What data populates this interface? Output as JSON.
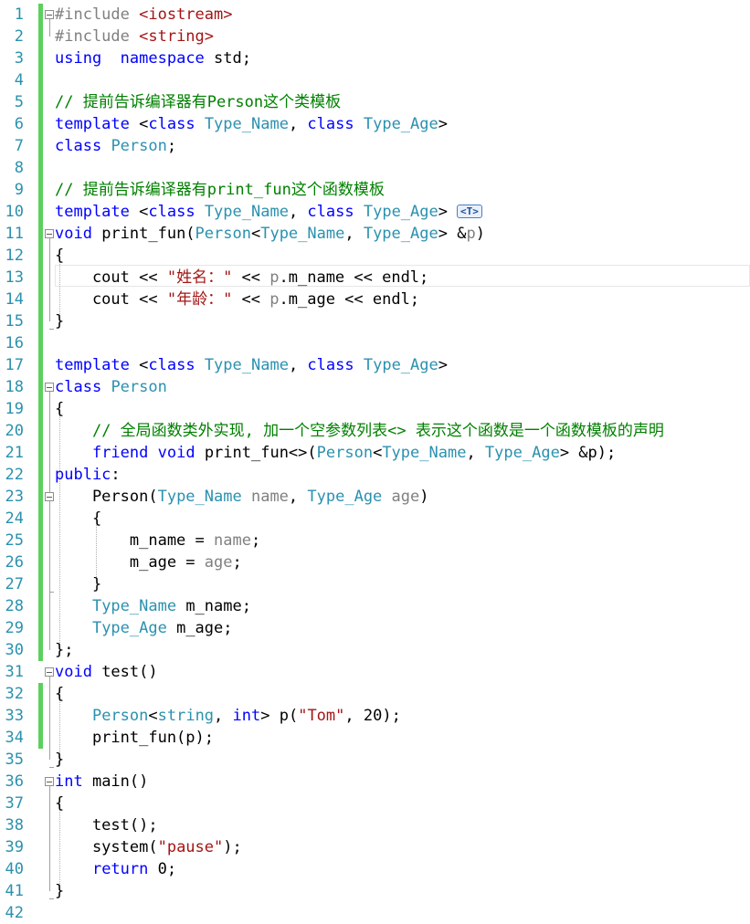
{
  "editor": {
    "colors": {
      "keyword": "#0000ff",
      "type": "#2b91af",
      "comment": "#008000",
      "string": "#a31515",
      "line_number": "#2b91af",
      "change_bar": "#5cd05c"
    },
    "line_numbers": [
      "1",
      "2",
      "3",
      "4",
      "5",
      "6",
      "7",
      "8",
      "9",
      "10",
      "11",
      "12",
      "13",
      "14",
      "15",
      "16",
      "17",
      "18",
      "19",
      "20",
      "21",
      "22",
      "23",
      "24",
      "25",
      "26",
      "27",
      "28",
      "29",
      "30",
      "31",
      "32",
      "33",
      "34",
      "35",
      "36",
      "37",
      "38",
      "39",
      "40",
      "41",
      "42"
    ],
    "hint_badge": "<T>",
    "lines": [
      [
        [
          "pp",
          "#include "
        ],
        [
          "st",
          "<iostream>"
        ]
      ],
      [
        [
          "pp",
          "#include "
        ],
        [
          "st",
          "<string>"
        ]
      ],
      [
        [
          "kw",
          "using"
        ],
        [
          "",
          "  "
        ],
        [
          "kw",
          "namespace"
        ],
        [
          "",
          " std;"
        ]
      ],
      [],
      [
        [
          "cm",
          "// 提前告诉编译器有Person这个类模板"
        ]
      ],
      [
        [
          "kw",
          "template"
        ],
        [
          "",
          " <"
        ],
        [
          "kw",
          "class"
        ],
        [
          "",
          " "
        ],
        [
          "ty",
          "Type_Name"
        ],
        [
          "",
          ", "
        ],
        [
          "kw",
          "class"
        ],
        [
          "",
          " "
        ],
        [
          "ty",
          "Type_Age"
        ],
        [
          "",
          ">"
        ]
      ],
      [
        [
          "kw",
          "class"
        ],
        [
          "",
          " "
        ],
        [
          "ty",
          "Person"
        ],
        [
          "",
          ";"
        ]
      ],
      [],
      [
        [
          "cm",
          "// 提前告诉编译器有print_fun这个函数模板"
        ]
      ],
      [
        [
          "kw",
          "template"
        ],
        [
          "",
          " <"
        ],
        [
          "kw",
          "class"
        ],
        [
          "",
          " "
        ],
        [
          "ty",
          "Type_Name"
        ],
        [
          "",
          ", "
        ],
        [
          "kw",
          "class"
        ],
        [
          "",
          " "
        ],
        [
          "ty",
          "Type_Age"
        ],
        [
          "",
          ">"
        ]
      ],
      [
        [
          "kw",
          "void"
        ],
        [
          "",
          " print_fun("
        ],
        [
          "ty",
          "Person"
        ],
        [
          "",
          "<"
        ],
        [
          "ty",
          "Type_Name"
        ],
        [
          "",
          ", "
        ],
        [
          "ty",
          "Type_Age"
        ],
        [
          "",
          "> &"
        ],
        [
          "pa",
          "p"
        ],
        [
          "",
          ")"
        ]
      ],
      [
        [
          "",
          "{"
        ]
      ],
      [
        [
          "",
          "    cout << "
        ],
        [
          "st",
          "\"姓名：\""
        ],
        [
          "",
          " << "
        ],
        [
          "pa",
          "p"
        ],
        [
          "",
          ".m_name << endl;"
        ]
      ],
      [
        [
          "",
          "    cout << "
        ],
        [
          "st",
          "\"年龄：\""
        ],
        [
          "",
          " << "
        ],
        [
          "pa",
          "p"
        ],
        [
          "",
          ".m_age << endl;"
        ]
      ],
      [
        [
          "",
          "}"
        ]
      ],
      [],
      [
        [
          "kw",
          "template"
        ],
        [
          "",
          " <"
        ],
        [
          "kw",
          "class"
        ],
        [
          "",
          " "
        ],
        [
          "ty",
          "Type_Name"
        ],
        [
          "",
          ", "
        ],
        [
          "kw",
          "class"
        ],
        [
          "",
          " "
        ],
        [
          "ty",
          "Type_Age"
        ],
        [
          "",
          ">"
        ]
      ],
      [
        [
          "kw",
          "class"
        ],
        [
          "",
          " "
        ],
        [
          "ty",
          "Person"
        ]
      ],
      [
        [
          "",
          "{"
        ]
      ],
      [
        [
          "",
          "    "
        ],
        [
          "cm",
          "// 全局函数类外实现, 加一个空参数列表<> 表示这个函数是一个函数模板的声明"
        ]
      ],
      [
        [
          "",
          "    "
        ],
        [
          "kw",
          "friend"
        ],
        [
          "",
          " "
        ],
        [
          "kw",
          "void"
        ],
        [
          "",
          " print_fun<>("
        ],
        [
          "ty",
          "Person"
        ],
        [
          "",
          "<"
        ],
        [
          "ty",
          "Type_Name"
        ],
        [
          "",
          ", "
        ],
        [
          "ty",
          "Type_Age"
        ],
        [
          "",
          "> &p);"
        ]
      ],
      [
        [
          "kw",
          "public"
        ],
        [
          "",
          ":"
        ]
      ],
      [
        [
          "",
          "    Person("
        ],
        [
          "ty",
          "Type_Name"
        ],
        [
          "",
          " "
        ],
        [
          "pa",
          "name"
        ],
        [
          "",
          ", "
        ],
        [
          "ty",
          "Type_Age"
        ],
        [
          "",
          " "
        ],
        [
          "pa",
          "age"
        ],
        [
          "",
          ")"
        ]
      ],
      [
        [
          "",
          "    {"
        ]
      ],
      [
        [
          "",
          "        m_name = "
        ],
        [
          "pa",
          "name"
        ],
        [
          "",
          ";"
        ]
      ],
      [
        [
          "",
          "        m_age = "
        ],
        [
          "pa",
          "age"
        ],
        [
          "",
          ";"
        ]
      ],
      [
        [
          "",
          "    }"
        ]
      ],
      [
        [
          "",
          "    "
        ],
        [
          "ty",
          "Type_Name"
        ],
        [
          "",
          " m_name;"
        ]
      ],
      [
        [
          "",
          "    "
        ],
        [
          "ty",
          "Type_Age"
        ],
        [
          "",
          " m_age;"
        ]
      ],
      [
        [
          "",
          "};"
        ]
      ],
      [
        [
          "kw",
          "void"
        ],
        [
          "",
          " test()"
        ]
      ],
      [
        [
          "",
          "{"
        ]
      ],
      [
        [
          "",
          "    "
        ],
        [
          "ty",
          "Person"
        ],
        [
          "",
          "<"
        ],
        [
          "ty",
          "string"
        ],
        [
          "",
          ", "
        ],
        [
          "kw",
          "int"
        ],
        [
          "",
          "> p("
        ],
        [
          "st",
          "\"Tom\""
        ],
        [
          "",
          ", 20);"
        ]
      ],
      [
        [
          "",
          "    print_fun(p);"
        ]
      ],
      [
        [
          "",
          "}"
        ]
      ],
      [
        [
          "kw",
          "int"
        ],
        [
          "",
          " main()"
        ]
      ],
      [
        [
          "",
          "{"
        ]
      ],
      [
        [
          "",
          "    test();"
        ]
      ],
      [
        [
          "",
          "    system("
        ],
        [
          "st",
          "\"pause\""
        ],
        [
          "",
          ");"
        ]
      ],
      [
        [
          "",
          "    "
        ],
        [
          "kw",
          "return"
        ],
        [
          "",
          " 0;"
        ]
      ],
      [
        [
          "",
          "}"
        ]
      ],
      []
    ],
    "fold_lines": [
      1,
      11,
      18,
      23,
      31,
      36
    ],
    "changed_lines": [
      1,
      2,
      3,
      4,
      5,
      6,
      7,
      8,
      9,
      10,
      11,
      12,
      13,
      14,
      15,
      16,
      17,
      18,
      19,
      20,
      21,
      22,
      23,
      24,
      25,
      26,
      27,
      28,
      29,
      30,
      32,
      33,
      34
    ]
  }
}
